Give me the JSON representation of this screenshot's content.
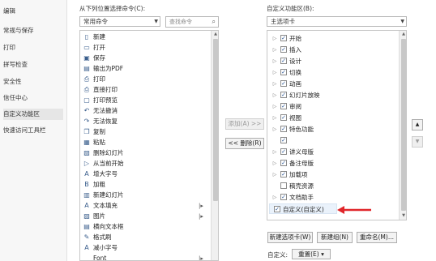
{
  "nav": {
    "items": [
      {
        "label": "编辑",
        "active": false
      },
      {
        "label": "常规与保存",
        "active": false
      },
      {
        "label": "打印",
        "active": false
      },
      {
        "label": "拼写检查",
        "active": false
      },
      {
        "label": "安全性",
        "active": false
      },
      {
        "label": "信任中心",
        "active": false
      },
      {
        "label": "自定义功能区",
        "active": true
      },
      {
        "label": "快速访问工具栏",
        "active": false
      }
    ]
  },
  "left_panel": {
    "label": "从下列位置选择命令(C):",
    "source_value": "常用命令",
    "search_placeholder": "查找命令",
    "commands": [
      {
        "icon": "new-document-icon",
        "glyph": "▯",
        "label": "新建",
        "submenu": false
      },
      {
        "icon": "open-folder-icon",
        "glyph": "▭",
        "label": "打开",
        "submenu": false
      },
      {
        "icon": "save-icon",
        "glyph": "▣",
        "label": "保存",
        "submenu": false
      },
      {
        "icon": "pdf-export-icon",
        "glyph": "▤",
        "label": "输出为PDF",
        "submenu": false
      },
      {
        "icon": "print-icon",
        "glyph": "⎙",
        "label": "打印",
        "submenu": false
      },
      {
        "icon": "direct-print-icon",
        "glyph": "⎙",
        "label": "直接打印",
        "submenu": false
      },
      {
        "icon": "print-preview-icon",
        "glyph": "▢",
        "label": "打印预览",
        "submenu": false
      },
      {
        "icon": "undo-icon",
        "glyph": "↶",
        "label": "无法撤消",
        "submenu": false
      },
      {
        "icon": "redo-icon",
        "glyph": "↷",
        "label": "无法恢复",
        "submenu": false
      },
      {
        "icon": "copy-icon",
        "glyph": "❐",
        "label": "复制",
        "submenu": false
      },
      {
        "icon": "paste-icon",
        "glyph": "▦",
        "label": "粘贴",
        "submenu": false
      },
      {
        "icon": "delete-slide-icon",
        "glyph": "▧",
        "label": "删除幻灯片",
        "submenu": false
      },
      {
        "icon": "play-current-icon",
        "glyph": "▷",
        "label": "从当前开始",
        "submenu": false
      },
      {
        "icon": "font-size-up-icon",
        "glyph": "A",
        "label": "增大字号",
        "submenu": false
      },
      {
        "icon": "bold-icon",
        "glyph": "B",
        "label": "加粗",
        "submenu": false
      },
      {
        "icon": "new-slide-icon",
        "glyph": "▥",
        "label": "新建幻灯片",
        "submenu": false
      },
      {
        "icon": "text-fill-icon",
        "glyph": "A",
        "label": "文本填充",
        "submenu": true
      },
      {
        "icon": "picture-icon",
        "glyph": "▨",
        "label": "图片",
        "submenu": true
      },
      {
        "icon": "textbox-icon",
        "glyph": "▤",
        "label": "横向文本框",
        "submenu": false
      },
      {
        "icon": "format-painter-icon",
        "glyph": "✎",
        "label": "格式刷",
        "submenu": false
      },
      {
        "icon": "font-size-down-icon",
        "glyph": "A",
        "label": "减小字号",
        "submenu": false
      },
      {
        "icon": "font-icon",
        "glyph": "",
        "label": "Font",
        "submenu": true
      }
    ]
  },
  "middle": {
    "add_label": "添加(A) >>",
    "remove_label": "<< 删除(R)"
  },
  "right_panel": {
    "label": "自定义功能区(B):",
    "scope_value": "主选项卡",
    "tabs": [
      {
        "label": "开始",
        "checked": true,
        "expandable": true
      },
      {
        "label": "插入",
        "checked": true,
        "expandable": true
      },
      {
        "label": "设计",
        "checked": true,
        "expandable": true
      },
      {
        "label": "切换",
        "checked": true,
        "expandable": true
      },
      {
        "label": "动画",
        "checked": true,
        "expandable": true
      },
      {
        "label": "幻灯片放映",
        "checked": true,
        "expandable": true
      },
      {
        "label": "审阅",
        "checked": true,
        "expandable": true
      },
      {
        "label": "视图",
        "checked": true,
        "expandable": true
      },
      {
        "label": "特色功能",
        "checked": true,
        "expandable": true
      },
      {
        "label": "",
        "checked": true,
        "expandable": false
      },
      {
        "label": "讲义母版",
        "checked": true,
        "expandable": true
      },
      {
        "label": "备注母版",
        "checked": true,
        "expandable": true
      },
      {
        "label": "加载项",
        "checked": true,
        "expandable": true
      },
      {
        "label": "稿壳资源",
        "checked": false,
        "expandable": false
      },
      {
        "label": "文档助手",
        "checked": true,
        "expandable": true
      },
      {
        "label": "自定义(自定义)",
        "checked": true,
        "expandable": false
      }
    ],
    "new_tab_label": "新建选项卡(W)",
    "new_group_label": "新建组(N)",
    "rename_label": "重命名(M)...",
    "customize_label": "自定义:",
    "reset_label": "重置(E)",
    "reset_arrow": "▾"
  },
  "move_up_glyph": "▲",
  "move_down_glyph": "▼",
  "colors": {
    "annotation_arrow": "#e0262a",
    "check": "#2b5797"
  }
}
